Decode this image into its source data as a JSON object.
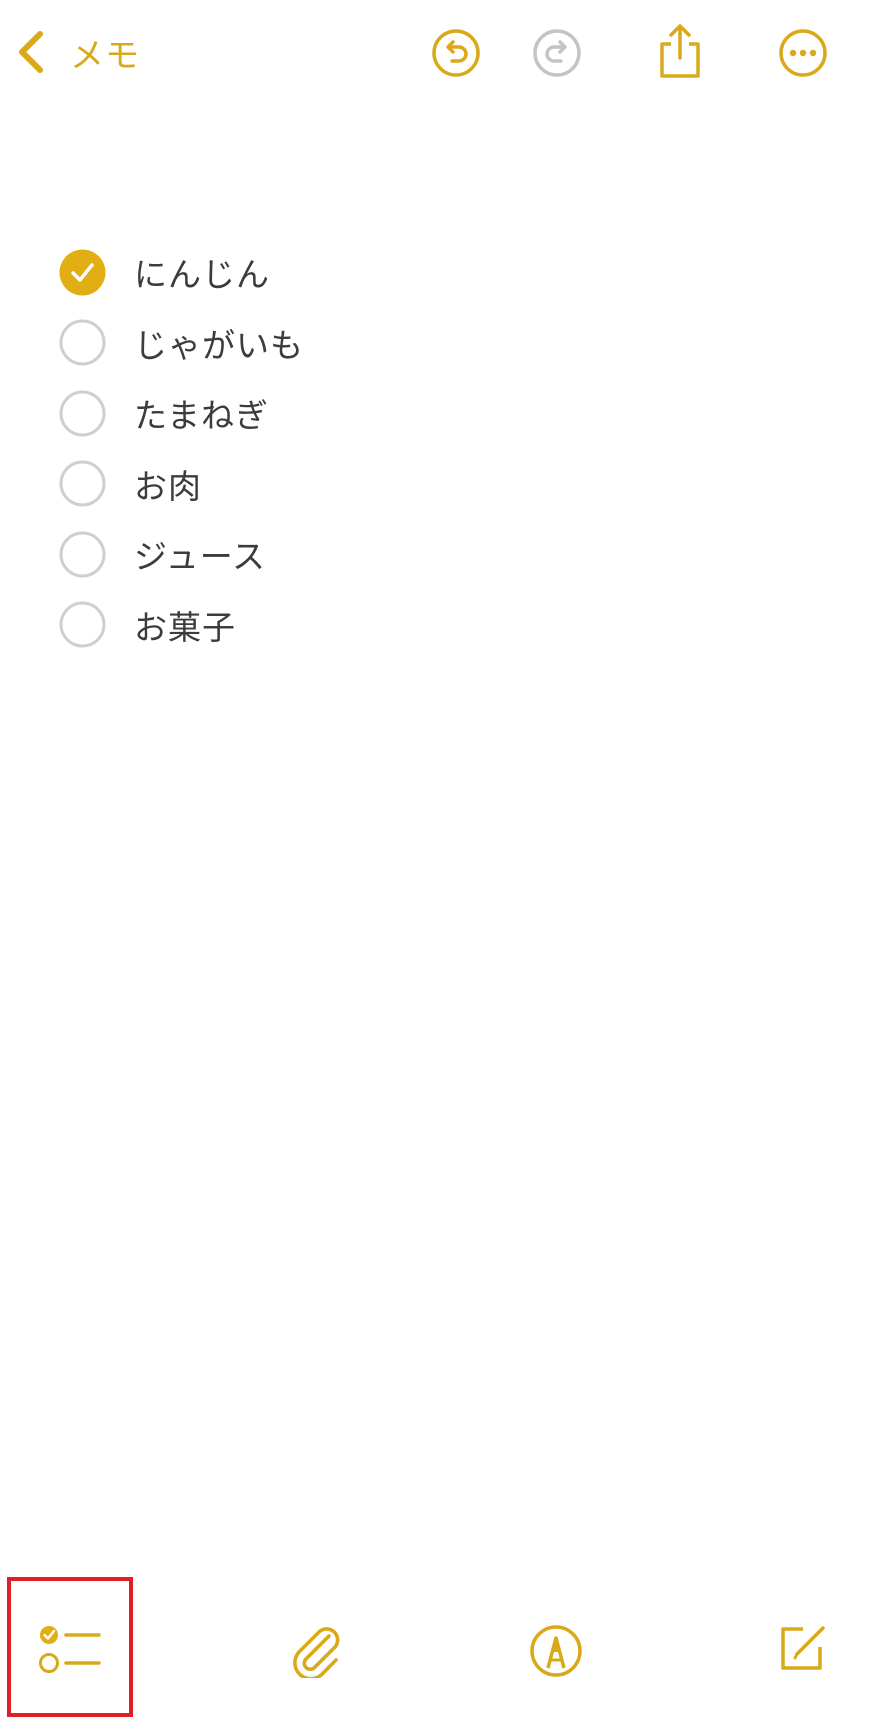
{
  "nav": {
    "back_label": "メモ",
    "icons": {
      "back": "chevron-left-icon",
      "undo": "undo-icon",
      "redo": "redo-icon",
      "share": "share-icon",
      "more": "ellipsis-circle-icon"
    }
  },
  "checklist": {
    "items": [
      {
        "label": "にんじん",
        "checked": true
      },
      {
        "label": "じゃがいも",
        "checked": false
      },
      {
        "label": "たまねぎ",
        "checked": false
      },
      {
        "label": "お肉",
        "checked": false
      },
      {
        "label": "ジュース",
        "checked": false
      },
      {
        "label": "お菓子",
        "checked": false
      }
    ]
  },
  "toolbar": {
    "icons": {
      "checklist": "checklist-icon",
      "attach": "paperclip-icon",
      "markup": "markup-pen-icon",
      "compose": "compose-icon"
    },
    "highlighted": "checklist"
  },
  "colors": {
    "accent": "#d9a91a",
    "disabled": "#c4c4c4",
    "text": "#3c3c3c",
    "unchecked_circle": "#cfcfcf",
    "highlight_box": "#e01f26"
  }
}
